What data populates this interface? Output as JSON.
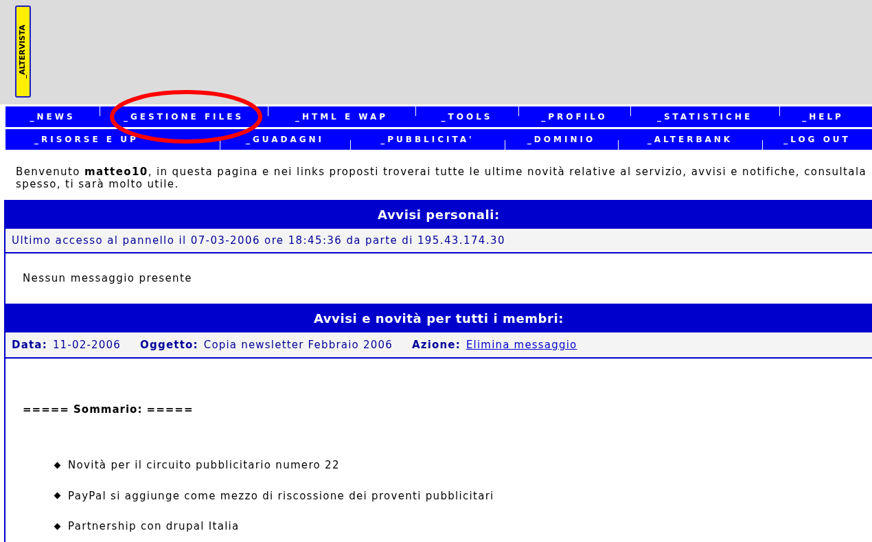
{
  "logo": {
    "text": "_ALTERVISTA"
  },
  "menu_rows": [
    [
      "_NEWS",
      "_GESTIONE FILES",
      "_HTML E WAP",
      "_TOOLS",
      "_PROFILO",
      "_STATISTICHE",
      "_HELP"
    ],
    [
      "_RISORSE E UP",
      "_GUADAGNI",
      "_PUBBLICITA'",
      "_DOMINIO",
      "_ALTERBANK",
      "_LOG OUT"
    ]
  ],
  "annotation": {
    "kind": "ellipse",
    "color": "#ff0000"
  },
  "welcome": "Benvenuto **matteo10**, in questa pagina e nei links proposti troverai tutte le ultime novità relative al servizio, avvisi e notifiche, consultala spesso, ti sarà molto utile.",
  "personal": {
    "title": "Avvisi personali:",
    "info": "Ultimo accesso al pannello il 07-03-2006 ore 18:45:36 da parte di 195.43.174.30",
    "message": "Nessun messaggio presente"
  },
  "members": {
    "title": "Avvisi e novità per tutti i membri:",
    "fields": [
      {
        "label": "Data:",
        "value": "11-02-2006",
        "kind": "text"
      },
      {
        "label": "Oggetto:",
        "value": "Copia newsletter Febbraio 2006",
        "kind": "text"
      },
      {
        "label": "Azione:",
        "value": "Elimina messaggio",
        "kind": "link"
      }
    ],
    "summary": "===== Sommario: =====",
    "items": [
      "Novità per il circuito pubblicitario numero 22",
      "PayPal si aggiunge come mezzo di riscossione dei proventi pubblicitari",
      "Partnership con drupal Italia"
    ]
  }
}
